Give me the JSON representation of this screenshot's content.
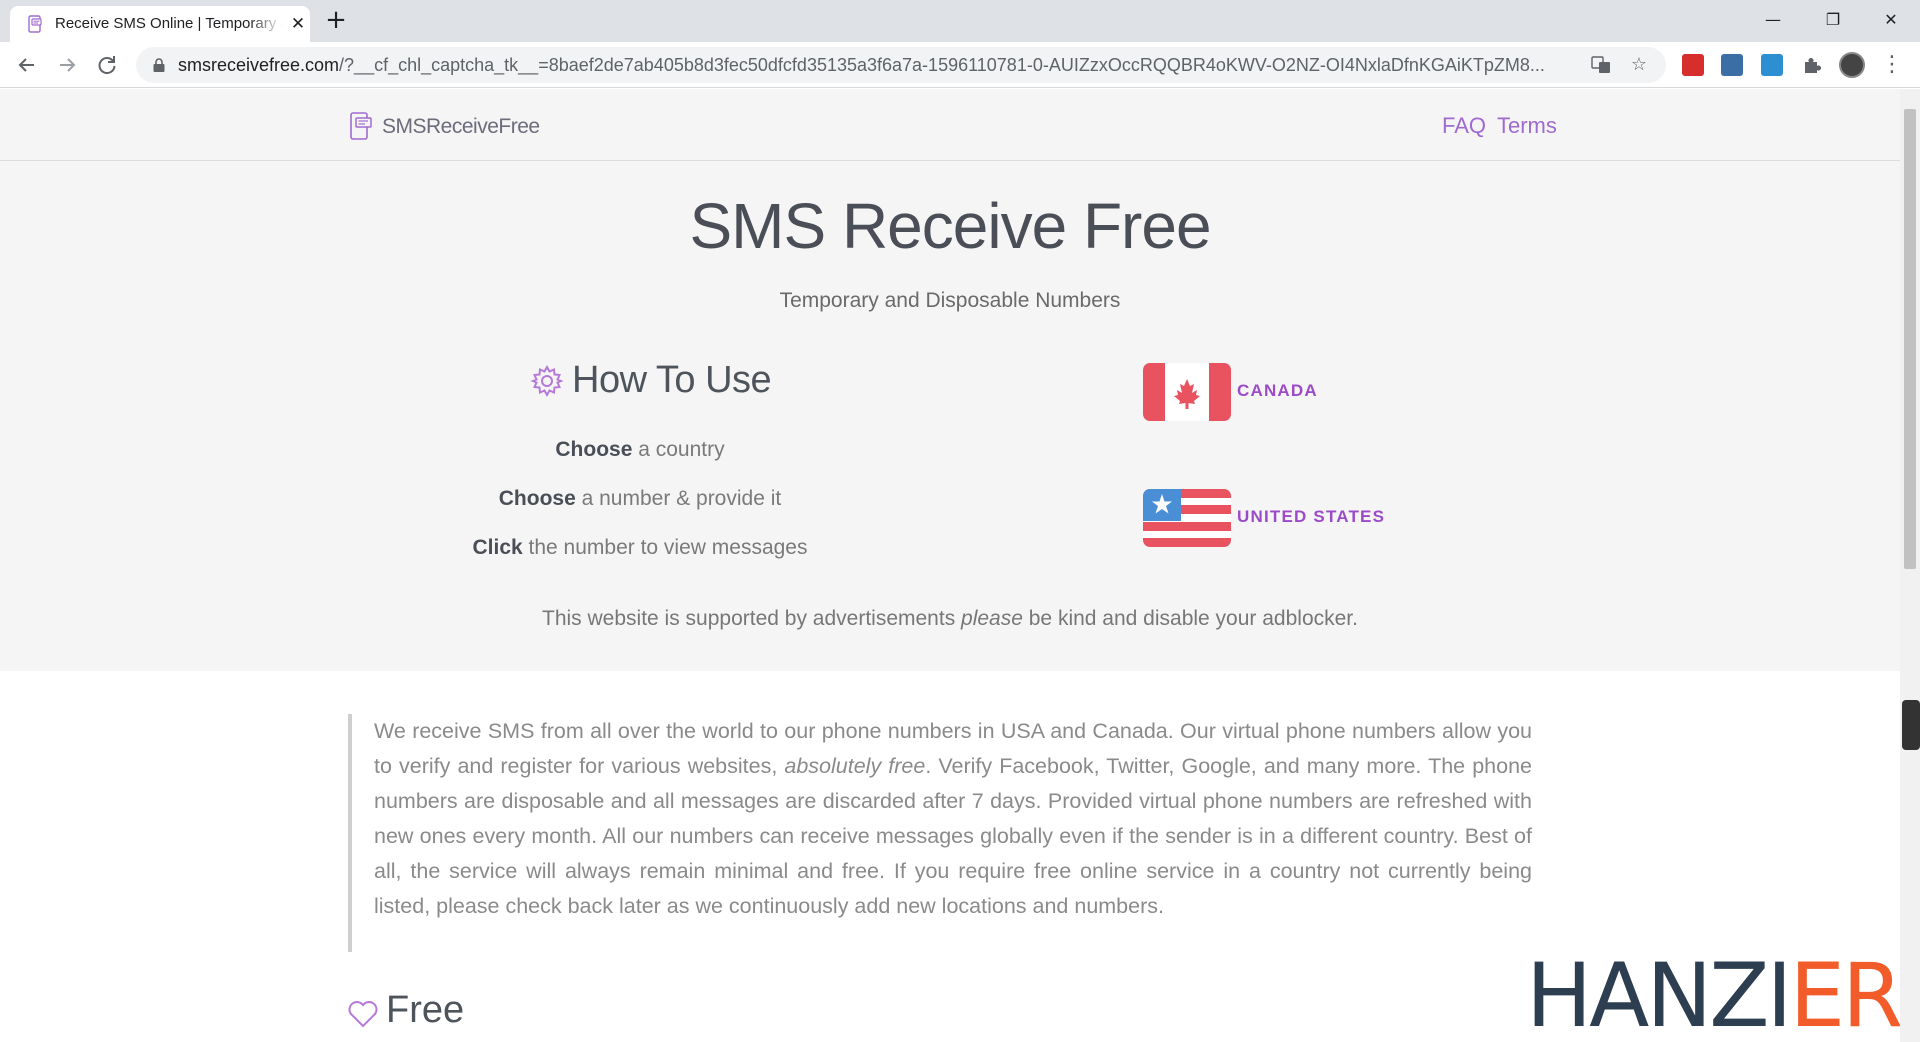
{
  "browser": {
    "tab_title": "Receive SMS Online | Temporary and Disposable Numbers",
    "tab_close": "✕",
    "new_tab": "+",
    "url_host": "smsreceivefree.com",
    "url_rest": "/?__cf_chl_captcha_tk__=8baef2de7ab405b8d3fec50dfcfd35135a3f6a7a-1596110781-0-AUIZzxOccRQQBR4oKWV-O2NZ-OI4NxlaDfnKGAiKTpZM8...",
    "window_minimize": "—",
    "window_restore": "❐",
    "window_close": "✕"
  },
  "nav": {
    "brand": "SMSReceiveFree",
    "links": [
      "FAQ",
      "Terms"
    ]
  },
  "hero": {
    "title": "SMS Receive Free",
    "subtitle": "Temporary and Disposable Numbers"
  },
  "howto": {
    "title": "How To Use",
    "steps": [
      {
        "bold": "Choose",
        "rest": " a country"
      },
      {
        "bold": "Choose",
        "rest": " a number & provide it"
      },
      {
        "bold": "Click",
        "rest": " the number to view messages"
      }
    ]
  },
  "countries": [
    "CANADA",
    "UNITED STATES"
  ],
  "adnote": {
    "before": "This website is supported by advertisements ",
    "italic": "please",
    "after": " be kind and disable your adblocker."
  },
  "intro": {
    "part1": "We receive SMS from all over the world to our phone numbers in USA and Canada. Our virtual phone numbers allow you to verify and register for various websites, ",
    "italic": "absolutely free",
    "part2": ". Verify Facebook, Twitter, Google, and many more. The phone numbers are disposable and all messages are discarded after 7 days. Provided virtual phone numbers are refreshed with new ones every month. All our numbers can receive messages globally even if the sender is in a different country. Best of all, the service will always remain minimal and free. If you require free online service in a country not currently being listed, please check back later as we continuously add new locations and numbers."
  },
  "free_section": {
    "title": "Free"
  },
  "watermark": {
    "part1": "HANZI",
    "part2": "ER"
  },
  "colors": {
    "accent": "#9b4bc7",
    "link": "#a06bd0",
    "flag_red": "#e8535f",
    "flag_blue": "#4a8fd6",
    "watermark_dark": "#2c3e50",
    "watermark_orange": "#f25c2a"
  },
  "icons": [
    "back-arrow-icon",
    "forward-arrow-icon",
    "reload-icon",
    "lock-icon",
    "translate-icon",
    "star-icon",
    "puzzle-icon",
    "gear-icon",
    "heart-icon",
    "phone-icon"
  ]
}
